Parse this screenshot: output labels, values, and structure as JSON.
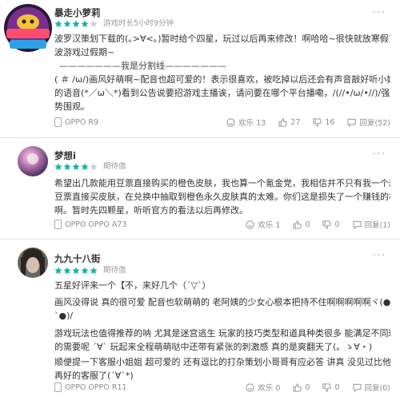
{
  "reviews": [
    {
      "username": "暴走小萝莉",
      "meta": "游戏时长5小时9分钟",
      "rating": 4,
      "lines": [
        "波罗汉策划下载的(｡>∀<｡)暂时给个四星，玩过以后再来修改！啊哈哈~很快就放寒假了",
        "波游戏过假期~",
        "———————我是分割线———————",
        "( ＃ /ω/)画风好萌啊~配音也超可爱的！表示很喜欢，被吃掉以后还会有声音敲好听小姐姐",
        "的语音(*／ω＼*)看到公告说要招游戏主播诶，请问要在哪个平台播嘞，/(//•/ω/•//)/强",
        "势围观。"
      ],
      "device": "OPPO R9",
      "likes_label": "欢乐 13",
      "thumbs_up": "27",
      "thumbs_down": "16",
      "reply_label": "回复(52)"
    },
    {
      "username": "梦想i",
      "meta": "期待值",
      "rating": 4,
      "lines": [
        "希望出几款能用豆票直接购买的橙色皮肤，我也算一个氪金党，我相信并不只有我一个想用",
        "豆票直接买皮肤，在兑换中抽取到橙色永久皮肤真的太难。你们这是损失了一个赚钱的机会",
        "啊。暂时先四颗星，听听官方的看法以后再修改。"
      ],
      "device": "OPPO OPPO A73",
      "likes_label": "欢乐 1",
      "thumbs_up": "0",
      "thumbs_down": "0",
      "reply_label": "回复(1)"
    },
    {
      "username": "九九十八街",
      "meta": "期待值",
      "rating": 5,
      "lines": [
        "五星好评来一个【不，来好几个（´▽`）",
        "画风没得说 真的很可爱 配音也软萌萌的 老阿姨的少女心根本把持不住啊啊啊啊啊ヾ(●´∇",
        "`●)/",
        "游戏玩法也值得推荐的呐 尤其是迷宫逃生 玩家的技巧类型和道具种类很多 能满足不同玩家",
        "的需要呢 ´∀` 玩起来全程萌萌哒中还带有紧张的刺激感 真的是爽翻天了(。ゝ∀・)",
        "顺便提一下客服小姐姐 超可爱的 还有逗比的打杂策划小哥哥有应必答 讲真 没见过比他们",
        "再好的客服了(´∀`*)"
      ],
      "device": "OPPO OPPO R11",
      "likes_label": "欢乐 0",
      "thumbs_up": "0",
      "thumbs_down": "0",
      "reply_label": "回复(0)"
    }
  ],
  "more_symbol": "···",
  "colors": {
    "star": "#17b2a6",
    "star_empty": "#cfcfcf"
  }
}
